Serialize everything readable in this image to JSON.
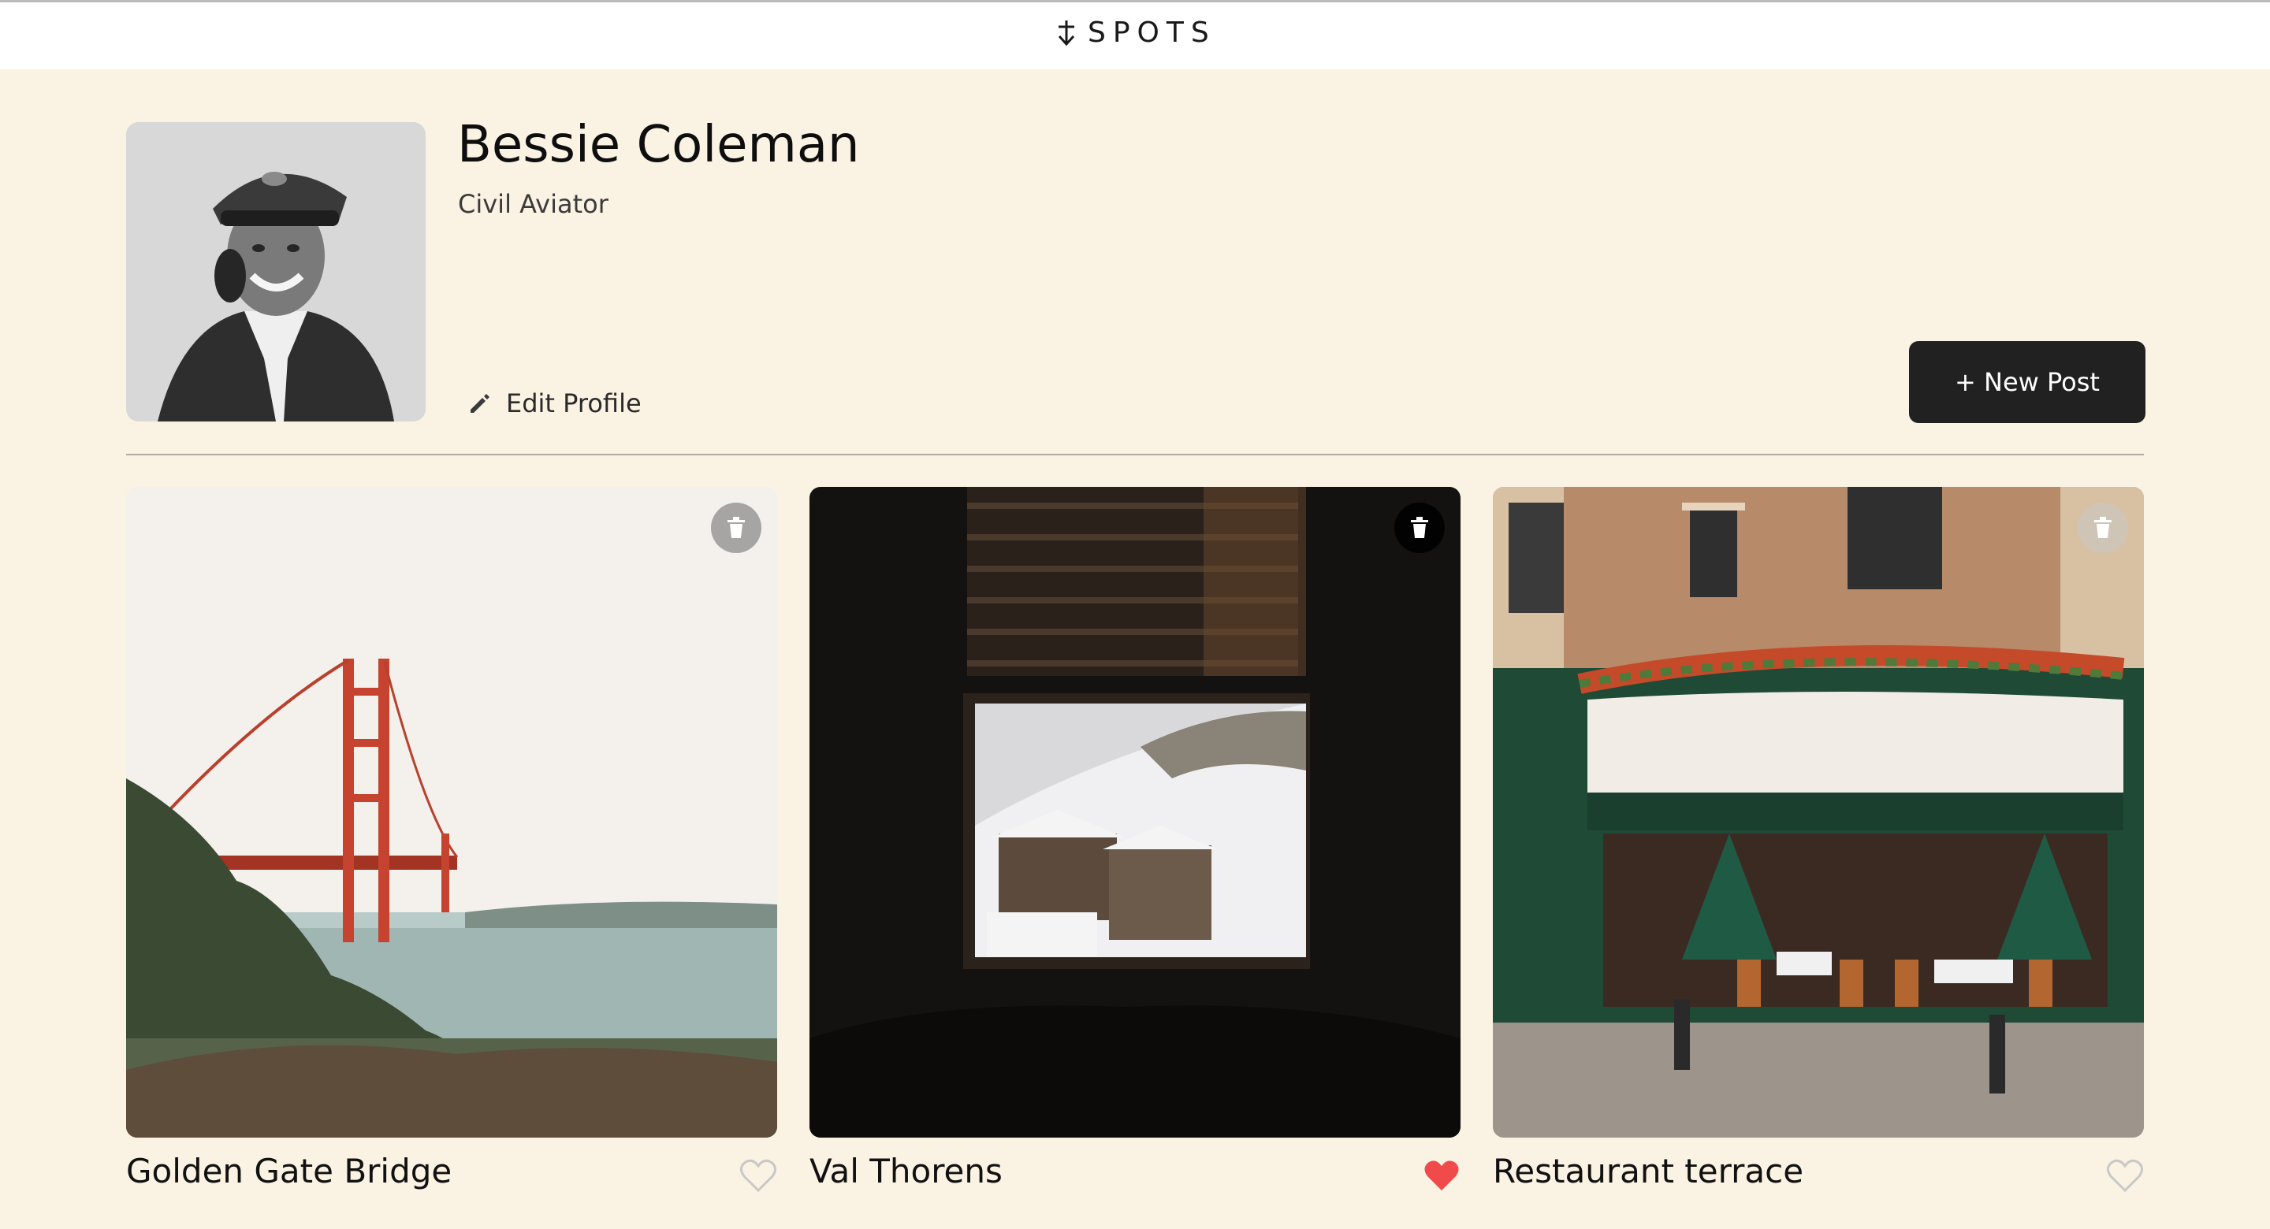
{
  "header": {
    "brand": "SPOTS",
    "brand_icon": "down-arrow-icon"
  },
  "profile": {
    "name": "Bessie Coleman",
    "role": "Civil Aviator",
    "edit_label": "Edit Profile",
    "new_post_label": "+ New Post"
  },
  "cards": [
    {
      "title": "Golden Gate Bridge",
      "liked": false
    },
    {
      "title": "Val Thorens",
      "liked": true
    },
    {
      "title": "Restaurant terrace",
      "liked": false
    }
  ],
  "colors": {
    "background": "#faf2e3",
    "button": "#212121",
    "heart_liked": "#f04a4a",
    "heart_outline": "#c8c8c8"
  }
}
